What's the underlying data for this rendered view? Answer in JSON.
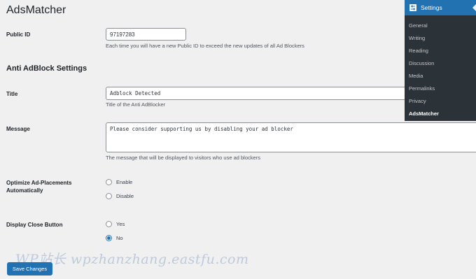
{
  "page": {
    "title": "AdsMatcher"
  },
  "public_id": {
    "label": "Public ID",
    "value": "97197283",
    "description": "Each time you will have a new Public ID to exceed the new updates of all Ad Blockers"
  },
  "anti_adblock": {
    "heading": "Anti AdBlock Settings",
    "title_field": {
      "label": "Title",
      "value": "Adblock Detected",
      "description": "Title of the Anti AdBlocker"
    },
    "message_field": {
      "label": "Message",
      "value": "Please consider supporting us by disabling your ad blocker",
      "description": "The message that will be displayed to visitors who use ad blockers"
    },
    "optimize": {
      "label_line1": "Optimize Ad-Placements",
      "label_line2": "Automatically",
      "options": [
        "Enable",
        "Disable"
      ],
      "selected": null
    },
    "close_button": {
      "label": "Display Close Button",
      "options": [
        "Yes",
        "No"
      ],
      "selected": "No"
    }
  },
  "actions": {
    "save_label": "Save Changes"
  },
  "watermark": {
    "text": "WP站长 wpzhanzhang.eastfu.com"
  },
  "admin_menu": {
    "header": "Settings",
    "header_icon": "settings-icon",
    "items": [
      "General",
      "Writing",
      "Reading",
      "Discussion",
      "Media",
      "Permalinks",
      "Privacy",
      "AdsMatcher"
    ],
    "current": "AdsMatcher",
    "colors": {
      "background": "#2c3338",
      "active": "#2271b1"
    }
  }
}
